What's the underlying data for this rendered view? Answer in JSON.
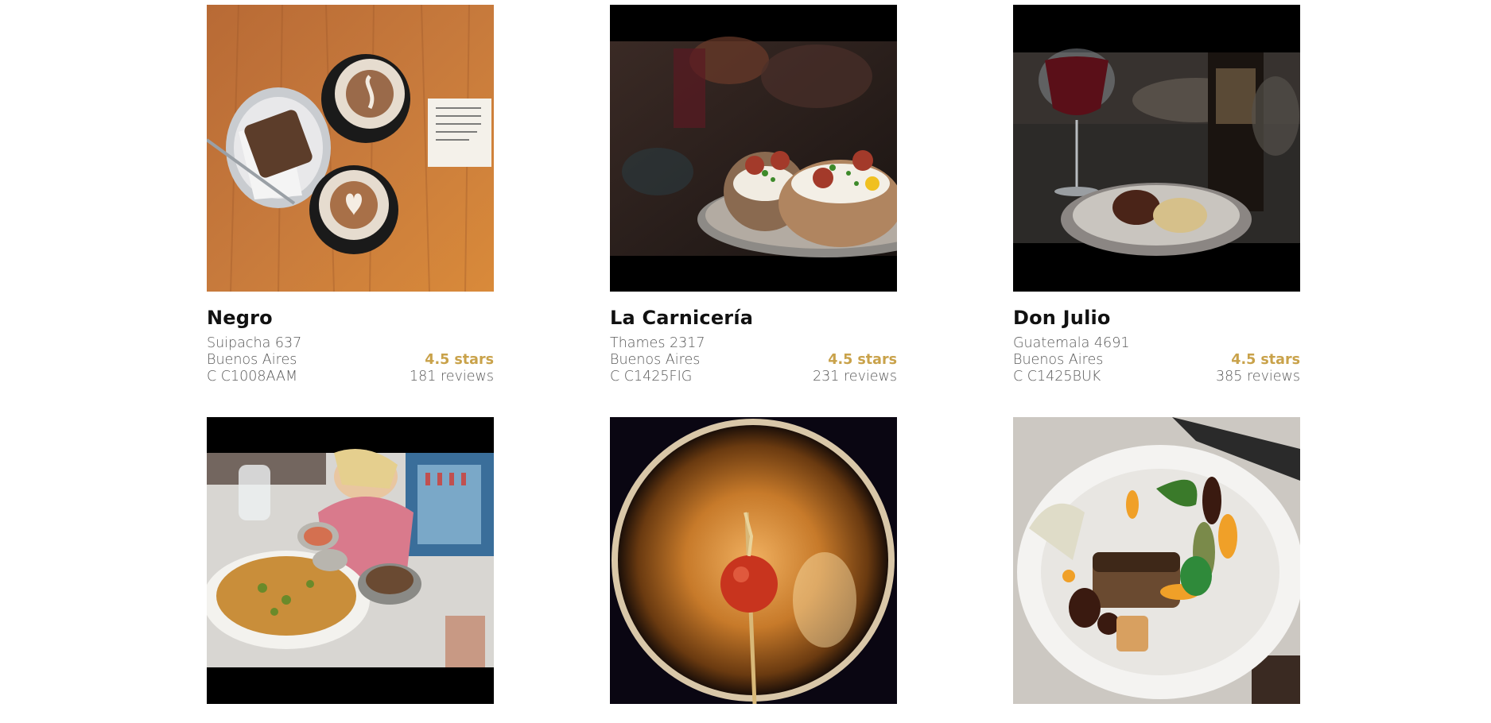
{
  "restaurants": [
    {
      "name": "Negro",
      "address_line1": "Suipacha 637",
      "address_line2": "Buenos Aires",
      "address_line3": "C C1008AAM",
      "rating": "4.5 stars",
      "reviews": "181 reviews",
      "photo": "coffee-and-cake-photo"
    },
    {
      "name": "La Carnicería",
      "address_line1": "Thames 2317",
      "address_line2": "Buenos Aires",
      "address_line3": "C C1425FIG",
      "rating": "4.5 stars",
      "reviews": "231 reviews",
      "photo": "stuffed-potatoes-photo"
    },
    {
      "name": "Don Julio",
      "address_line1": "Guatemala 4691",
      "address_line2": "Buenos Aires",
      "address_line3": "C C1425BUK",
      "rating": "4.5 stars",
      "reviews": "385 reviews",
      "photo": "wine-and-sausage-photo"
    },
    {
      "name": "",
      "photo": "pasta-dinner-table-photo"
    },
    {
      "name": "",
      "photo": "cocktail-glass-photo"
    },
    {
      "name": "",
      "photo": "plated-pork-dish-photo"
    }
  ],
  "colors": {
    "rating": "#c9a24a",
    "name": "#111111",
    "meta": "#5a5a5a"
  }
}
